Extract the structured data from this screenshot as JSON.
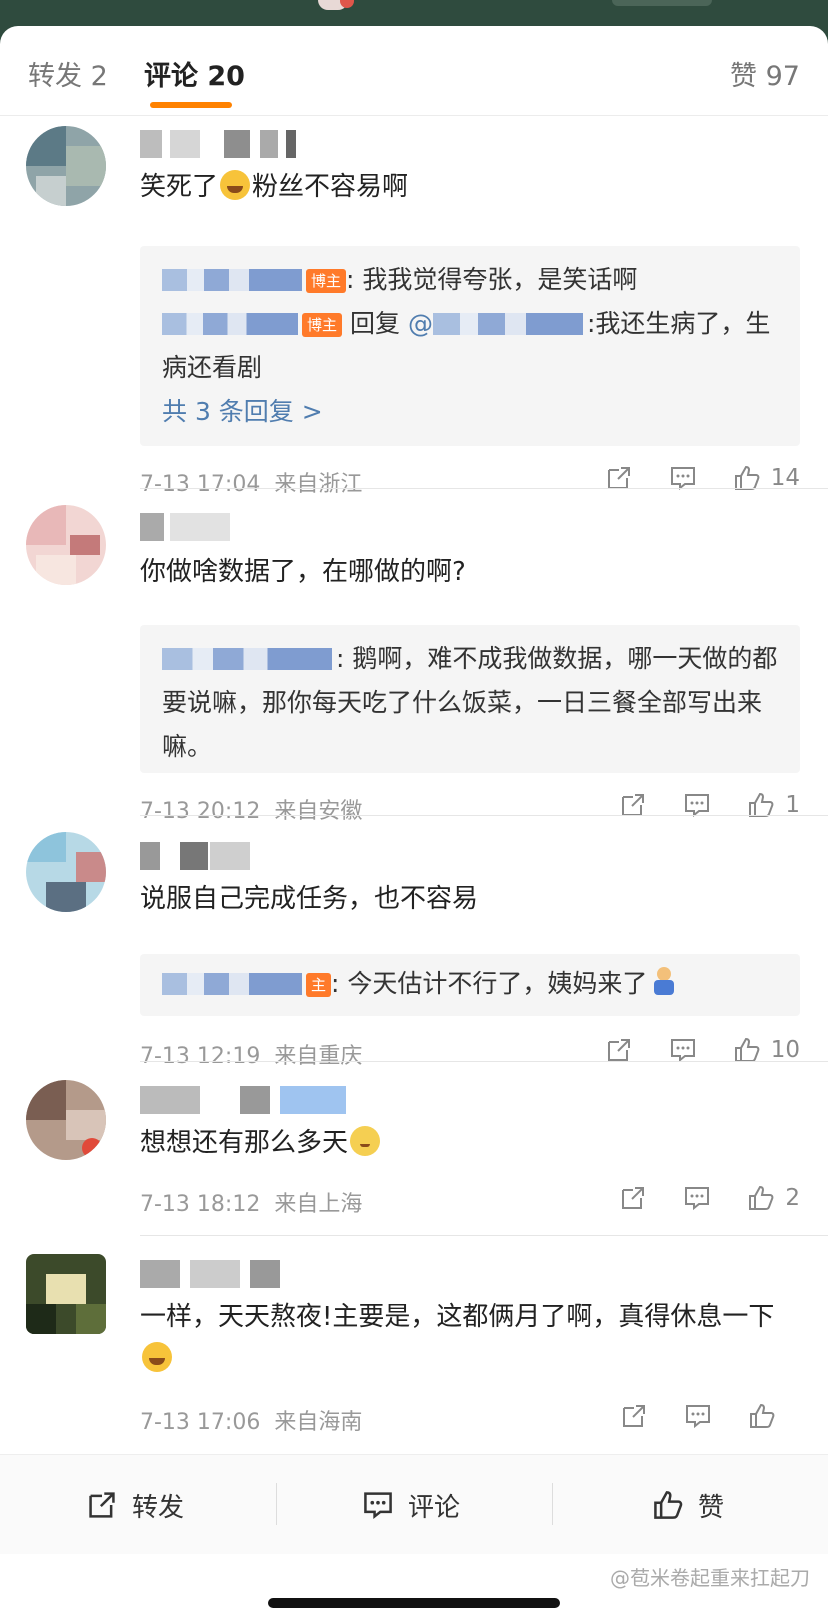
{
  "tabs": {
    "repost": "转发 2",
    "comments": "评论 20",
    "likes": "赞 97"
  },
  "comments": [
    {
      "text_before": "笑死了",
      "emoji": "laughing-tears-icon",
      "text_after": "粉丝不容易啊",
      "replies": [
        {
          "badge": "博主",
          "text": ": 我我觉得夸张，是笑话啊"
        },
        {
          "badge": "博主",
          "prefix": "回复",
          "mention": "@",
          "text": ":我还生病了，生病还看剧"
        }
      ],
      "more_replies": "共 3 条回复 >",
      "time": "7-13 17:04",
      "location": "来自浙江",
      "likes": "14"
    },
    {
      "text": "你做啥数据了，在哪做的啊?",
      "replies": [
        {
          "text": ": 鹅啊，难不成我做数据，哪一天做的都要说嘛，那你每天吃了什么饭菜，一日三餐全部写出来嘛。"
        }
      ],
      "time": "7-13 20:12",
      "location": "来自安徽",
      "likes": "1"
    },
    {
      "text": "说服自己完成任务，也不容易",
      "replies": [
        {
          "badge": "主",
          "text": ": 今天估计不行了，姨妈来了"
        }
      ],
      "time": "7-13 12:19",
      "location": "来自重庆",
      "likes": "10"
    },
    {
      "text": "想想还有那么多天",
      "emoji": "sweat-face-icon",
      "time": "7-13 18:12",
      "location": "来自上海",
      "likes": "2"
    },
    {
      "text": "一样，天天熬夜!主要是，这都俩月了啊，真得休息一下",
      "emoji": "laughing-tears-icon",
      "time": "7-13 17:06",
      "location": "来自海南",
      "likes": ""
    }
  ],
  "bottom_bar": {
    "repost": "转发",
    "comment": "评论",
    "like": "赞"
  },
  "watermark": "@苞米卷起重来扛起刀"
}
